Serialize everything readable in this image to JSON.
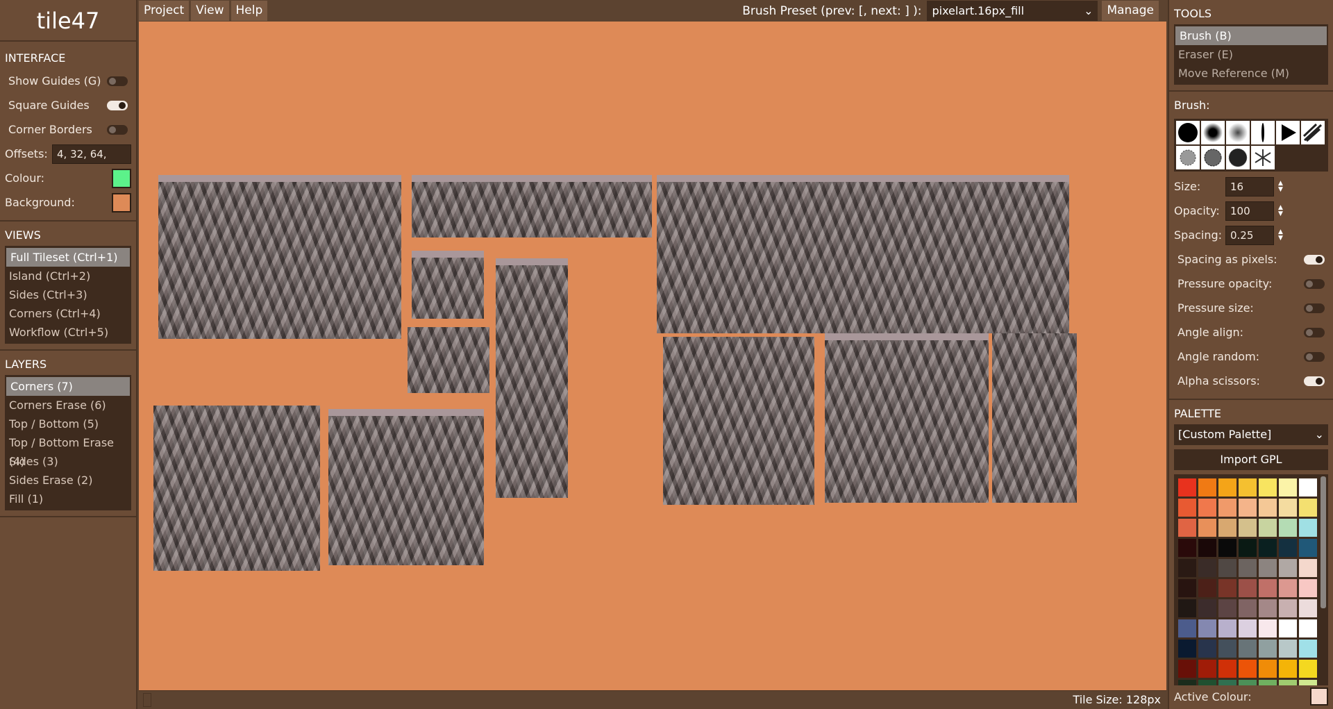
{
  "app_title": "tile47",
  "interface": {
    "heading": "INTERFACE",
    "show_guides": "Show Guides (G)",
    "square_guides": "Square Guides",
    "corner_borders": "Corner Borders",
    "offsets_label": "Offsets:",
    "offsets_value": "4, 32, 64,",
    "colour_label": "Colour:",
    "colour_value": "#5cf28a",
    "background_label": "Background:",
    "background_value": "#de8a57"
  },
  "views": {
    "heading": "VIEWS",
    "items": [
      "Full Tileset (Ctrl+1)",
      "Island (Ctrl+2)",
      "Sides (Ctrl+3)",
      "Corners (Ctrl+4)",
      "Workflow (Ctrl+5)"
    ]
  },
  "layers": {
    "heading": "LAYERS",
    "items": [
      "Corners (7)",
      "Corners Erase (6)",
      "Top / Bottom (5)",
      "Top / Bottom Erase (4)",
      "Sides (3)",
      "Sides Erase (2)",
      "Fill (1)"
    ]
  },
  "menu": {
    "project": "Project",
    "view": "View",
    "help": "Help",
    "preset_label": "Brush Preset (prev: [, next: ] ):",
    "preset_value": "pixelart.16px_fill",
    "manage": "Manage"
  },
  "status": {
    "tile_size": "Tile Size: 128px"
  },
  "tools": {
    "heading": "TOOLS",
    "items": [
      "Brush (B)",
      "Eraser (E)",
      "Move Reference (M)"
    ]
  },
  "brush": {
    "heading": "Brush:",
    "size_label": "Size:",
    "size_value": "16",
    "opacity_label": "Opacity:",
    "opacity_value": "100",
    "spacing_label": "Spacing:",
    "spacing_value": "0.25",
    "spacing_pixels": "Spacing as pixels:",
    "pressure_opacity": "Pressure opacity:",
    "pressure_size": "Pressure size:",
    "angle_align": "Angle align:",
    "angle_random": "Angle random:",
    "alpha_scissors": "Alpha scissors:"
  },
  "palette": {
    "heading": "PALETTE",
    "selected": "[Custom Palette]",
    "import": "Import GPL",
    "active_label": "Active Colour:",
    "active_colour": "#f5d8cc",
    "colours": [
      "#e8321e",
      "#f07a14",
      "#f4a418",
      "#f4c030",
      "#f8e460",
      "#fbf3a8",
      "#ffffff",
      "#e85a32",
      "#f0784c",
      "#f09a6a",
      "#f4b48a",
      "#f4c896",
      "#f4dca0",
      "#f4e070",
      "#e06444",
      "#e8905a",
      "#d8a870",
      "#d4c08c",
      "#c8d4a0",
      "#b4dcb4",
      "#a0e0e4",
      "#2a0a0a",
      "#1a0808",
      "#0a0a0a",
      "#0a1a14",
      "#0a2020",
      "#143040",
      "#205878",
      "#2a1a14",
      "#3a2c28",
      "#504844",
      "#6c6460",
      "#8c8480",
      "#b0a8a4",
      "#f4d8cc",
      "#281410",
      "#4c2018",
      "#783428",
      "#9c5048",
      "#c07068",
      "#dc9890",
      "#f8c8c4",
      "#201814",
      "#3c2c2c",
      "#5c4444",
      "#806464",
      "#a48888",
      "#c8b0b0",
      "#ecdcdc",
      "#4c5c8c",
      "#8488b0",
      "#b8b0cc",
      "#dcd0e0",
      "#f8e8ec",
      "#ffffff",
      "#ffffff",
      "#0a1a30",
      "#28344c",
      "#44505c",
      "#687478",
      "#90a0a0",
      "#b8c8c8",
      "#a0e0e8",
      "#681008",
      "#a01c08",
      "#d03008",
      "#ec5408",
      "#f08c08",
      "#f4b408",
      "#f4d820",
      "#1a2c1c",
      "#205030",
      "#307050",
      "#4c9058",
      "#70b060",
      "#a0cc70",
      "#d0e890"
    ]
  }
}
